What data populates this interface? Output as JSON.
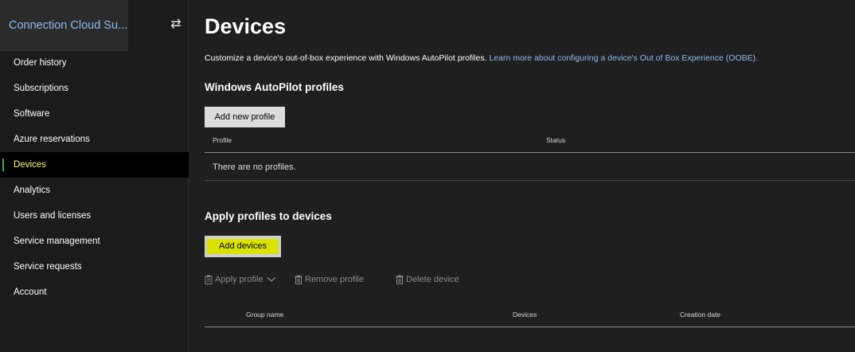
{
  "sidebar": {
    "title": "Connection Cloud Su...",
    "swap_icon": "⇄",
    "items": [
      {
        "label": "Order history"
      },
      {
        "label": "Subscriptions"
      },
      {
        "label": "Software"
      },
      {
        "label": "Azure reservations"
      },
      {
        "label": "Devices",
        "active": true
      },
      {
        "label": "Analytics"
      },
      {
        "label": "Users and licenses"
      },
      {
        "label": "Service management"
      },
      {
        "label": "Service requests"
      },
      {
        "label": "Account"
      }
    ]
  },
  "main": {
    "title": "Devices",
    "intro_text": "Customize a device's out-of-box experience with Windows AutoPilot profiles.",
    "intro_link": "Learn more about configuring a device's Out of Box Experience (OOBE).",
    "profiles_section": {
      "title": "Windows AutoPilot profiles",
      "add_button": "Add new profile",
      "columns": [
        "Profile",
        "Status"
      ],
      "empty_text": "There are no profiles."
    },
    "devices_section": {
      "title": "Apply profiles to devices",
      "add_button": "Add devices",
      "toolbar": {
        "apply_profile": "Apply profile",
        "remove_profile": "Remove profile",
        "delete_device": "Delete device"
      },
      "columns": [
        "Group name",
        "Devices",
        "Creation date"
      ]
    }
  },
  "colors": {
    "background": "#1f1f1f",
    "link": "#8dbbf0",
    "active_nav_text": "#ffff66",
    "highlight": "#d9e200"
  }
}
